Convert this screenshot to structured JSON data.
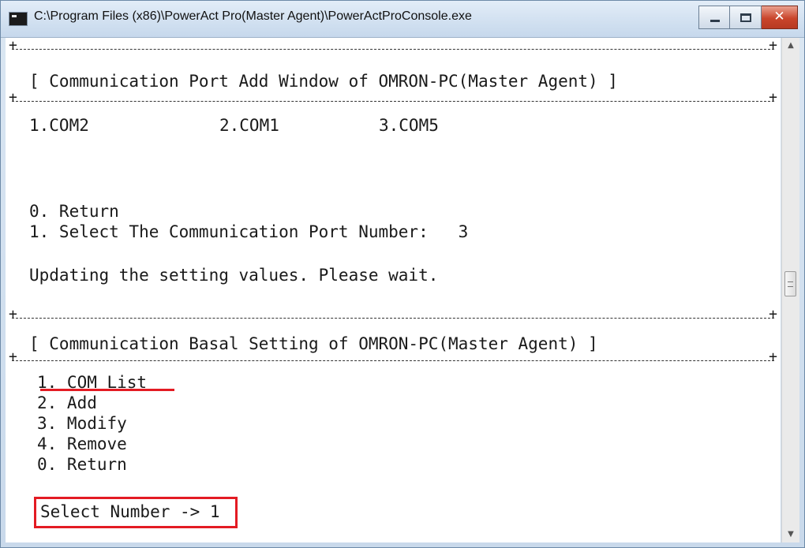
{
  "window": {
    "title": "C:\\Program Files (x86)\\PowerAct Pro(Master Agent)\\PowerActProConsole.exe",
    "icon": "console-app-icon",
    "buttons": {
      "minimize_icon": "minimize-icon",
      "maximize_icon": "maximize-icon",
      "close_label": "✕"
    }
  },
  "console": {
    "port_add_header": "[ Communication Port Add Window of OMRON-PC(Master Agent) ]",
    "ports": [
      "1.COM2",
      "2.COM1",
      "3.COM5"
    ],
    "port_menu": [
      "0. Return",
      "1. Select The Communication Port Number:   3"
    ],
    "status": "Updating the setting values. Please wait.",
    "basal_header": "[ Communication Basal Setting of OMRON-PC(Master Agent) ]",
    "basal_menu": [
      "1. COM List",
      "2. Add",
      "3. Modify",
      "4. Remove",
      "0. Return"
    ],
    "prompt": "Select Number -> 1"
  },
  "scrollbar": {
    "up_arrow": "▲",
    "down_arrow": "▼",
    "position": 0.46
  },
  "colors": {
    "highlight": "#e31b23",
    "close_button": "#c9452b",
    "titlebar": "#d5e3f2"
  }
}
